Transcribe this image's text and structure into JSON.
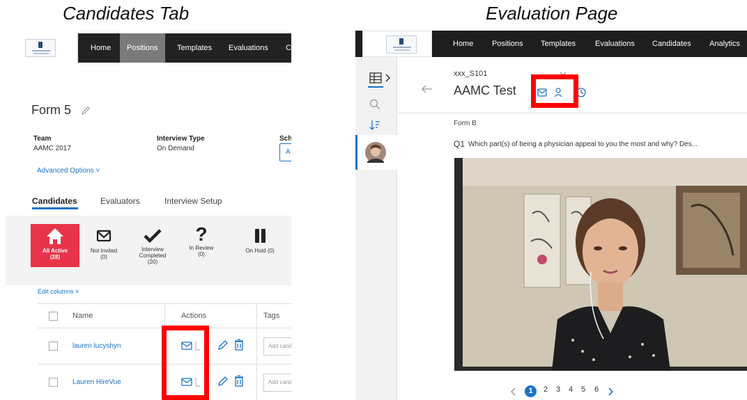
{
  "captions": {
    "left": "Candidates Tab",
    "right": "Evaluation Page"
  },
  "left_panel": {
    "nav": [
      "Home",
      "Positions",
      "Templates",
      "Evaluations",
      "C"
    ],
    "nav_active": "Positions",
    "form_title": "Form 5",
    "meta": [
      {
        "label": "Team",
        "value": "AAMC 2017"
      },
      {
        "label": "Interview Type",
        "value": "On Demand"
      },
      {
        "label": "Sch",
        "value": ""
      }
    ],
    "schedule_input_value": "A",
    "advanced_options": "Advanced Options",
    "tabs": [
      "Candidates",
      "Evaluators",
      "Interview Setup"
    ],
    "status_items": [
      {
        "icon": "home-icon",
        "label": "All Active",
        "count": "(28)"
      },
      {
        "icon": "envelope-icon",
        "label": "Not Invited",
        "count": "(0)"
      },
      {
        "icon": "checkmark-icon",
        "label": "Interview Completed",
        "count": "(20)"
      },
      {
        "icon": "question-icon",
        "label": "In Review",
        "count": "(0)"
      },
      {
        "icon": "pause-icon",
        "label": "On Hold (0)",
        "count": ""
      }
    ],
    "edit_columns": "Edit columns",
    "columns": [
      "Name",
      "Actions",
      "Tags"
    ],
    "rows": [
      {
        "name": "lauren lucyshyn",
        "tag_placeholder": "Add candi"
      },
      {
        "name": "Lauren HireVue",
        "tag_placeholder": "Add candi"
      }
    ]
  },
  "right_panel": {
    "nav": [
      "Home",
      "Positions",
      "Templates",
      "Evaluations",
      "Candidates",
      "Analytics"
    ],
    "candidate_id": "xxx_S101",
    "candidate_name": "AAMC Test",
    "form_label": "Form B",
    "question_number": "Q1",
    "question_text": "Which part(s) of being a physician appeal to you the most and why? Des...",
    "pagination": [
      "1",
      "2",
      "3",
      "4",
      "5",
      "6"
    ],
    "current_page": "1"
  },
  "colors": {
    "nav_dark": "#222222",
    "nav_active": "#7a7a7a",
    "accent_blue": "#1a73c8",
    "status_active": "#e8344a",
    "highlight_red": "#ff0000"
  }
}
